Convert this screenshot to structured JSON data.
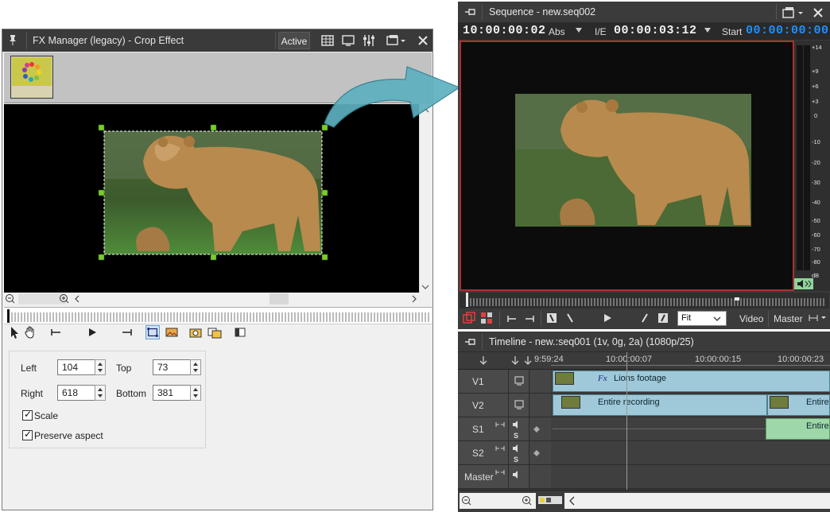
{
  "fx_manager": {
    "title": "FX Manager (legacy) - Crop Effect",
    "active_label": "Active",
    "params": {
      "left_label": "Left",
      "left_value": "104",
      "top_label": "Top",
      "top_value": "73",
      "right_label": "Right",
      "right_value": "618",
      "bottom_label": "Bottom",
      "bottom_value": "381",
      "scale_label": "Scale",
      "scale_checked": true,
      "preserve_label": "Preserve aspect",
      "preserve_checked": true
    }
  },
  "sequence": {
    "title": "Sequence - new.seq002",
    "timecode_current": "10:00:00:02",
    "abs_label": "Abs",
    "ie_label": "I/E",
    "timecode_duration": "00:00:03:12",
    "start_label": "Start",
    "timecode_start": "00:00:00:00",
    "zoom_value": "Fit",
    "video_label": "Video",
    "master_label": "Master",
    "meter_scale": [
      "+14",
      "+9",
      "+6",
      "+3",
      "0",
      "-10",
      "-20",
      "-30",
      "-40",
      "-50",
      "-60",
      "-70",
      "-80",
      "dB"
    ]
  },
  "timeline": {
    "title": "Timeline - new.:seq001 (1v, 0g, 2a) (1080p/25)",
    "ruler": [
      "9:59:24",
      "10:00:00:07",
      "10:00:00:15",
      "10:00:00:23"
    ],
    "tracks": [
      {
        "name": "V1",
        "clips": [
          {
            "label": "Lions footage"
          }
        ]
      },
      {
        "name": "V2",
        "clips": [
          {
            "label": "Entire recording"
          },
          {
            "label": "Entire"
          }
        ]
      },
      {
        "name": "S1",
        "clips": [
          {
            "label": "Entire"
          }
        ]
      },
      {
        "name": "S2",
        "clips": []
      },
      {
        "name": "Master",
        "clips": []
      }
    ],
    "fx_badge": "Fx"
  },
  "colors": {
    "accent_timecode": "#1e90ff",
    "viewer_border": "#a83232",
    "video_clip": "#9fc9d8",
    "audio_clip": "#9ed8a8",
    "arrow": "#5fb0bf"
  }
}
